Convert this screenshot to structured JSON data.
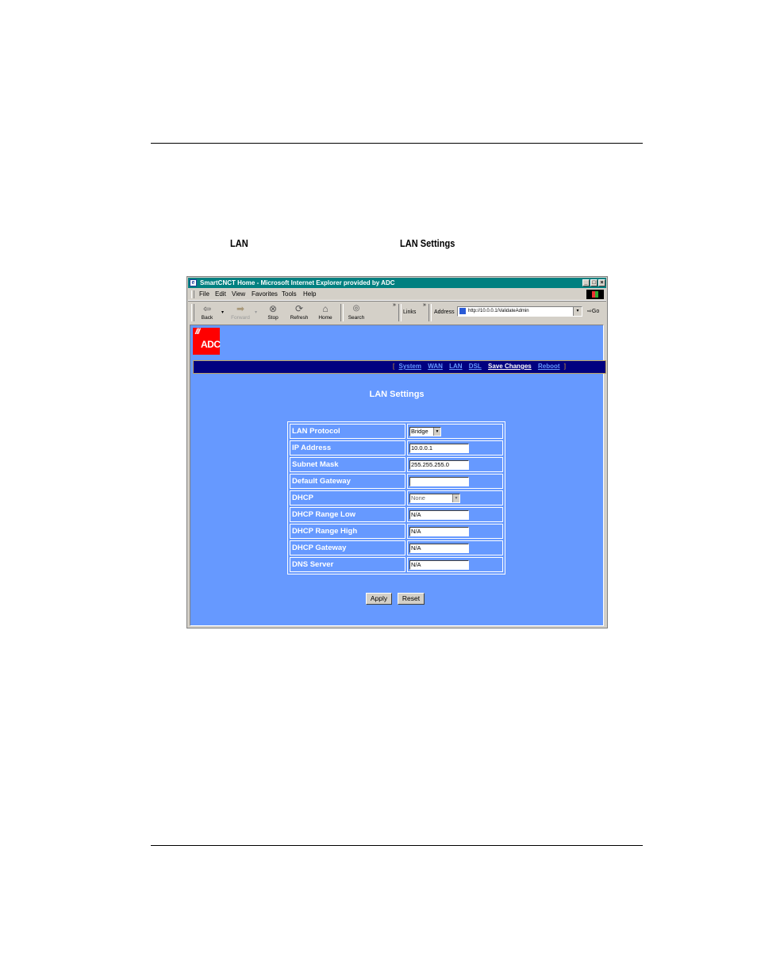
{
  "document": {
    "intro_words": [
      "LAN",
      "LAN Settings"
    ]
  },
  "browser": {
    "title": "SmartCNCT Home - Microsoft Internet Explorer provided by ADC",
    "window_buttons": [
      "_",
      "□",
      "×"
    ],
    "menu": [
      "File",
      "Edit",
      "View",
      "Favorites",
      "Tools",
      "Help"
    ],
    "toolbar": [
      {
        "label": "Back",
        "icon": "back-arrow-icon",
        "glyph": "⇦",
        "enabled": true
      },
      {
        "label": "Forward",
        "icon": "forward-arrow-icon",
        "glyph": "➡",
        "enabled": false
      },
      {
        "label": "Stop",
        "icon": "stop-icon",
        "glyph": "⊗",
        "enabled": true
      },
      {
        "label": "Refresh",
        "icon": "refresh-icon",
        "glyph": "⟳",
        "enabled": true
      },
      {
        "label": "Home",
        "icon": "home-icon",
        "glyph": "⌂",
        "enabled": true
      },
      {
        "label": "Search",
        "icon": "search-icon",
        "glyph": "🔍",
        "enabled": true
      }
    ],
    "chevron": "»",
    "links_label": "Links",
    "address_label": "Address",
    "address_value": "http://10.0.0.1/ValidateAdmin",
    "go_label": "Go"
  },
  "page": {
    "logo_text": "ADC",
    "logo_marks": "///",
    "nav": {
      "open_bracket": "[",
      "close_bracket": "]",
      "links": [
        "System",
        "WAN",
        "LAN",
        "DSL",
        "Save Changes",
        "Reboot"
      ],
      "current": "Save Changes"
    },
    "title": "LAN Settings",
    "form": [
      {
        "label": "LAN Protocol",
        "type": "select",
        "value": "Bridge"
      },
      {
        "label": "IP Address",
        "type": "text",
        "value": "10.0.0.1"
      },
      {
        "label": "Subnet Mask",
        "type": "text",
        "value": "255.255.255.0"
      },
      {
        "label": "Default Gateway",
        "type": "text",
        "value": ""
      },
      {
        "label": "DHCP",
        "type": "select",
        "value": "None"
      },
      {
        "label": "DHCP Range Low",
        "type": "text",
        "value": "N/A"
      },
      {
        "label": "DHCP Range High",
        "type": "text",
        "value": "N/A"
      },
      {
        "label": "DHCP Gateway",
        "type": "text",
        "value": "N/A"
      },
      {
        "label": "DNS Server",
        "type": "text",
        "value": "N/A"
      }
    ],
    "buttons": {
      "apply": "Apply",
      "reset": "Reset"
    }
  },
  "colors": {
    "titlebar": "#008080",
    "page_bg": "#6699ff",
    "navbar_bg": "#000080",
    "logo_bg": "#ff0000"
  }
}
